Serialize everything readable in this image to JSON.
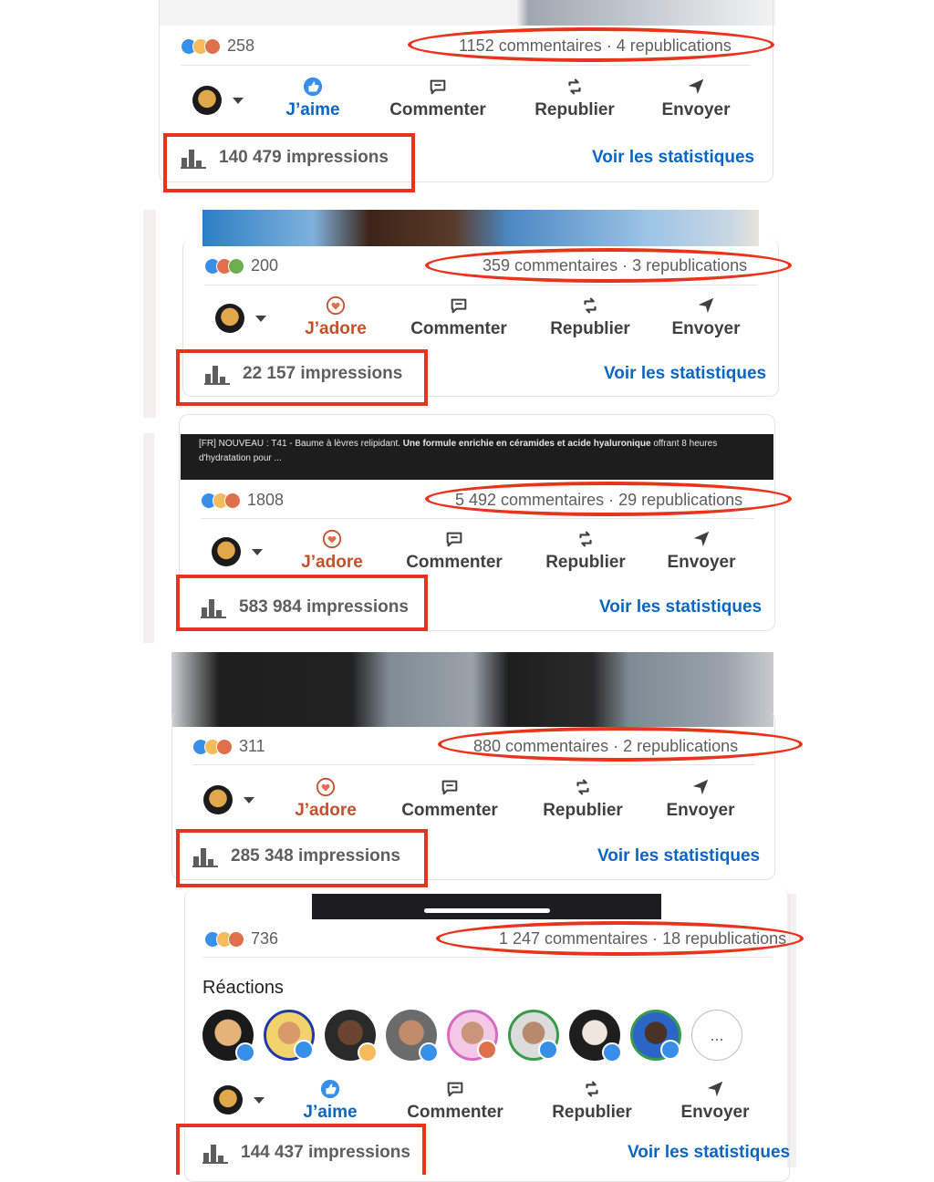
{
  "colors": {
    "accent": "#0a66c2",
    "love": "#c3502a",
    "highlight": "#e8341c"
  },
  "icons": {
    "like": "thumbs-up-icon",
    "love": "heart-icon",
    "comment": "comment-icon",
    "repost": "repost-icon",
    "send": "send-icon",
    "stats": "bar-chart-icon"
  },
  "labels": {
    "comment": "Commenter",
    "repost": "Republier",
    "send": "Envoyer",
    "see_stats": "Voir les statistiques"
  },
  "banner": {
    "prefix": "[FR] NOUVEAU : T41 - Baume à lèvres relipidant. ",
    "bold": "Une formule enrichie en céramides et acide hyaluronique",
    "suffix": " offrant 8 heures d'hydratation pour ..."
  },
  "posts": [
    {
      "reactions": "258",
      "comments": "1152 commentaires · 4 republications",
      "action": "J’aime",
      "impressions": "140 479 impressions"
    },
    {
      "reactions": "200",
      "comments": "359 commentaires · 3 republications",
      "action": "J’adore",
      "impressions": "22 157 impressions"
    },
    {
      "reactions": "1808",
      "comments": "5 492 commentaires · 29 republications",
      "action": "J’adore",
      "impressions": "583 984 impressions"
    },
    {
      "reactions": "311",
      "comments": "880 commentaires · 2 republications",
      "action": "J’adore",
      "impressions": "285 348 impressions"
    },
    {
      "reactions": "736",
      "comments": "1 247 commentaires · 18 republications",
      "action": "J’aime",
      "impressions": "144 437 impressions",
      "reactions_title": "Réactions",
      "more": "..."
    }
  ]
}
